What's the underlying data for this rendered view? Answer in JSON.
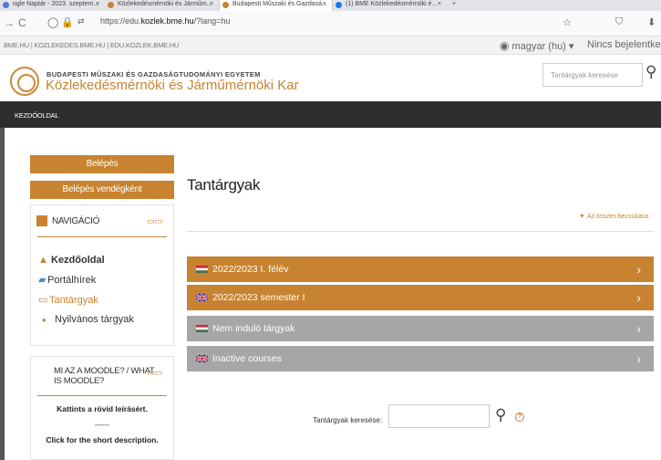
{
  "browser": {
    "tabs": [
      {
        "label": "ogle Naptár - 2023. szeptem...",
        "close": "×",
        "active": false
      },
      {
        "label": "Közlekedésmérnöki és Járműm...",
        "close": "×",
        "active": false
      },
      {
        "label": "Budapesti Műszaki és Gazdasá...",
        "close": "×",
        "active": true
      },
      {
        "label": "(1) BME Közlekedésmérnöki é...",
        "close": "×",
        "active": false
      },
      {
        "label": "+",
        "close": "",
        "active": false
      }
    ],
    "url_prefix": "https://edu.",
    "url_host": "kozlek.bme.hu",
    "url_path": "/?lang=hu"
  },
  "topline": {
    "links": "BME.HU | KOZLEKEDES.BME.HU | EDU.KOZLEK.BME.HU",
    "language": "magyar (hu) ▾",
    "login_status": "Nincs bejelentkezve"
  },
  "header": {
    "university": "BUDAPESTI MŰSZAKI ÉS GAZDASÁGTUDOMÁNYI EGYETEM",
    "faculty": "Közlekedésmérnöki és Járműmérnöki Kar",
    "search_placeholder": "Tantárgyak keresése"
  },
  "navbar": {
    "home": "KEZDŐOLDAL"
  },
  "sidebar": {
    "login_button": "Belépés",
    "guest_button": "Belépés vendégként",
    "navigation": {
      "title": "NAVIGÁCIÓ",
      "items": [
        {
          "label": "Kezdőoldal",
          "icon": "home-icon",
          "bold": true
        },
        {
          "label": "Portálhírek",
          "icon": "news-icon"
        },
        {
          "label": "Tantárgyak",
          "icon": "folder-icon",
          "accent": true
        },
        {
          "label": "Nyilvános tárgyak",
          "icon": "bullet-icon"
        }
      ]
    },
    "moodle": {
      "title_line1": "MI AZ A MOODLE? / WHAT",
      "title_line2": "IS MOODLE?",
      "text_hu": "Kattints a rövid leírásért.",
      "divider": "------",
      "text_en": "Click for the short description."
    }
  },
  "main": {
    "title": "Tantárgyak",
    "collapse_all": "Az összes becsukása",
    "categories": [
      {
        "label": "2022/2023 I. félév",
        "flag": "hu-flag",
        "color": "#c7832f"
      },
      {
        "label": "2022/2023 semester I",
        "flag": "uk-flag",
        "color": "#c7832f"
      },
      {
        "label": "Nem induló tárgyak",
        "flag": "hu-flag",
        "color": "#a6a6a6"
      },
      {
        "label": "Inactive courses",
        "flag": "uk-flag",
        "color": "#a6a6a6"
      }
    ],
    "course_search_label": "Tantárgyak keresése:"
  },
  "colors": {
    "accent": "#c7832f",
    "grey": "#a6a6a6",
    "navbar": "#2e2e2e"
  }
}
